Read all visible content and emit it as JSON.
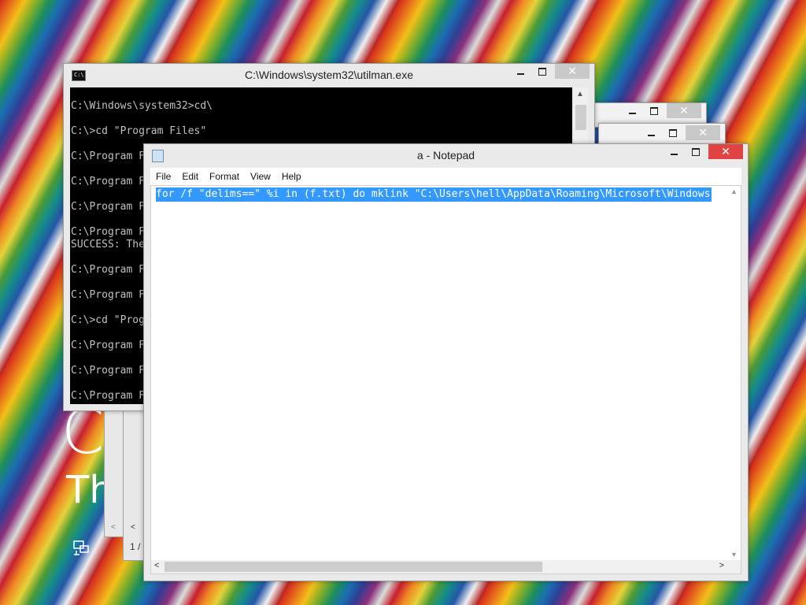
{
  "lockscreen": {
    "big_text": "C",
    "sub_text": "Th"
  },
  "cmd_window": {
    "title": "C:\\Windows\\system32\\utilman.exe",
    "icon_label": "C:\\",
    "lines": [
      "C:\\Windows\\system32>cd\\",
      "",
      "C:\\>cd \"Program Files\"",
      "",
      "C:\\Program F",
      "",
      "C:\\Program F",
      "",
      "C:\\Program F",
      "",
      "C:\\Program F",
      "SUCCESS: The",
      "",
      "C:\\Program F",
      "",
      "C:\\Program F",
      "",
      "C:\\>cd \"Prog",
      "",
      "C:\\Program F",
      "",
      "C:\\Program F",
      "",
      "C:\\Program F"
    ]
  },
  "notepad": {
    "title": "a - Notepad",
    "menu": {
      "file": "File",
      "edit": "Edit",
      "format": "Format",
      "view": "View",
      "help": "Help"
    },
    "content": "for /f \"delims==\" %i in (f.txt) do mklink \"C:\\Users\\hell\\AppData\\Roaming\\Microsoft\\Windows"
  },
  "background_dialog": {
    "status_text": "1 /"
  },
  "window_controls": {
    "close_glyph": "✕"
  }
}
